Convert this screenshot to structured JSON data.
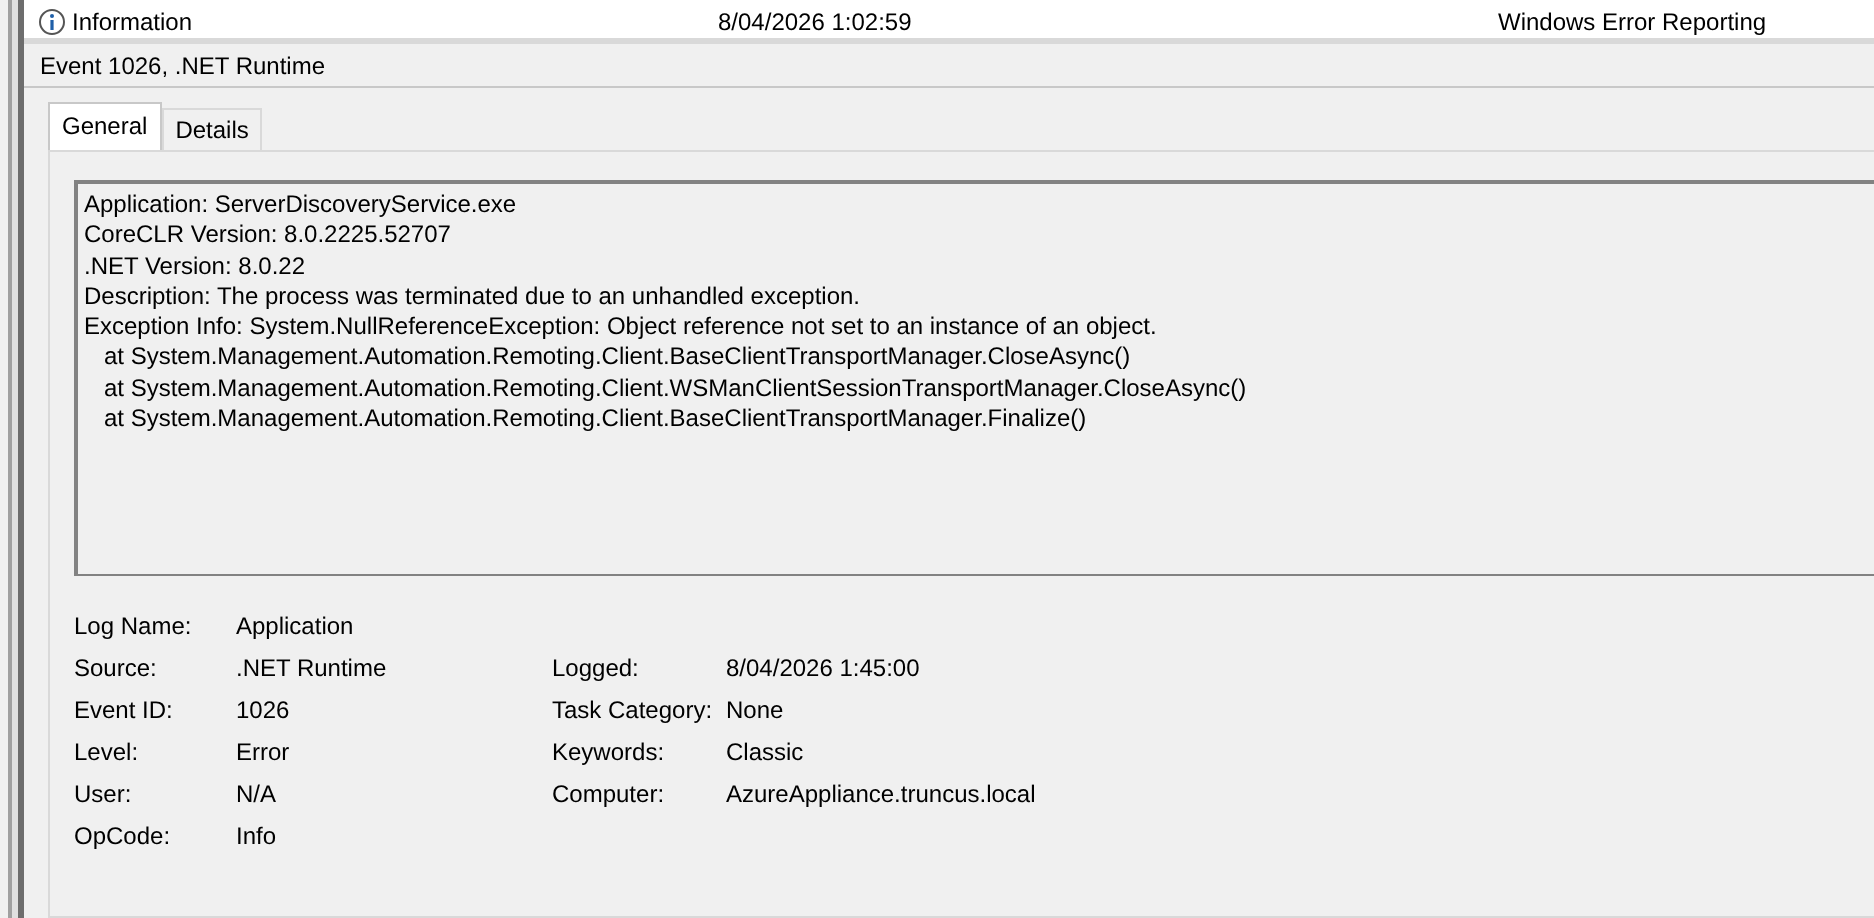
{
  "list_row": {
    "level": "Information",
    "date_time": "8/04/2026 1:02:59",
    "source": "Windows Error Reporting"
  },
  "header": {
    "title": "Event 1026, .NET Runtime"
  },
  "tabs": [
    {
      "label": "General",
      "selected": true
    },
    {
      "label": "Details",
      "selected": false
    }
  ],
  "description": [
    "Application: ServerDiscoveryService.exe",
    "CoreCLR Version: 8.0.2225.52707",
    ".NET Version: 8.0.22",
    "Description: The process was terminated due to an unhandled exception.",
    "Exception Info: System.NullReferenceException: Object reference not set to an instance of an object.",
    "   at System.Management.Automation.Remoting.Client.BaseClientTransportManager.CloseAsync()",
    "   at System.Management.Automation.Remoting.Client.WSManClientSessionTransportManager.CloseAsync()",
    "   at System.Management.Automation.Remoting.Client.BaseClientTransportManager.Finalize()"
  ],
  "properties": [
    {
      "label": "Log Name:",
      "value": "Application"
    },
    {
      "label": "Source:",
      "value": ".NET Runtime",
      "right_label": "Logged:",
      "right_value": "8/04/2026 1:45:00"
    },
    {
      "label": "Event ID:",
      "value": "1026",
      "right_label": "Task Category:",
      "right_value": "None"
    },
    {
      "label": "Level:",
      "value": "Error",
      "right_label": "Keywords:",
      "right_value": "Classic"
    },
    {
      "label": "User:",
      "value": "N/A",
      "right_label": "Computer:",
      "right_value": "AzureAppliance.truncus.local"
    },
    {
      "label": "OpCode:",
      "value": "Info"
    }
  ]
}
